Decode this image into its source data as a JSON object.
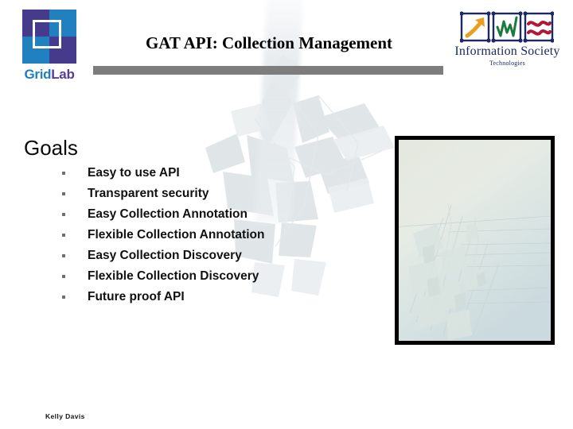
{
  "slide": {
    "title": "GAT API: Collection Management",
    "footer_name": "Kelly Davis"
  },
  "brand_logo": {
    "name_part1": "Grid",
    "name_part2": "Lab",
    "colors": {
      "purple": "#463a8c",
      "blue": "#2080c0",
      "text_blue": "#1f7fc0",
      "text_purple": "#5b3a9e"
    }
  },
  "ist_logo": {
    "title": "Information Society",
    "subtitle": "Technologies",
    "icons": [
      "arrow-up-right-icon",
      "zigzag-chart-icon",
      "wave-lines-icon"
    ],
    "colors": {
      "frame": "#1b2a60",
      "arrow": "#e8a020",
      "zigzag": "#1c7a3c",
      "waves": "#b01838",
      "text": "#1b2a60"
    }
  },
  "content": {
    "heading": "Goals",
    "bullets": [
      "Easy to use API",
      "Transparent security",
      "Easy Collection Annotation",
      "Flexible Collection Annotation",
      "Easy Collection Discovery",
      "Flexible Collection Discovery",
      "Future proof API"
    ]
  },
  "decor": {
    "rule_color": "#7d7d7d",
    "frame_border_color": "#000000"
  }
}
